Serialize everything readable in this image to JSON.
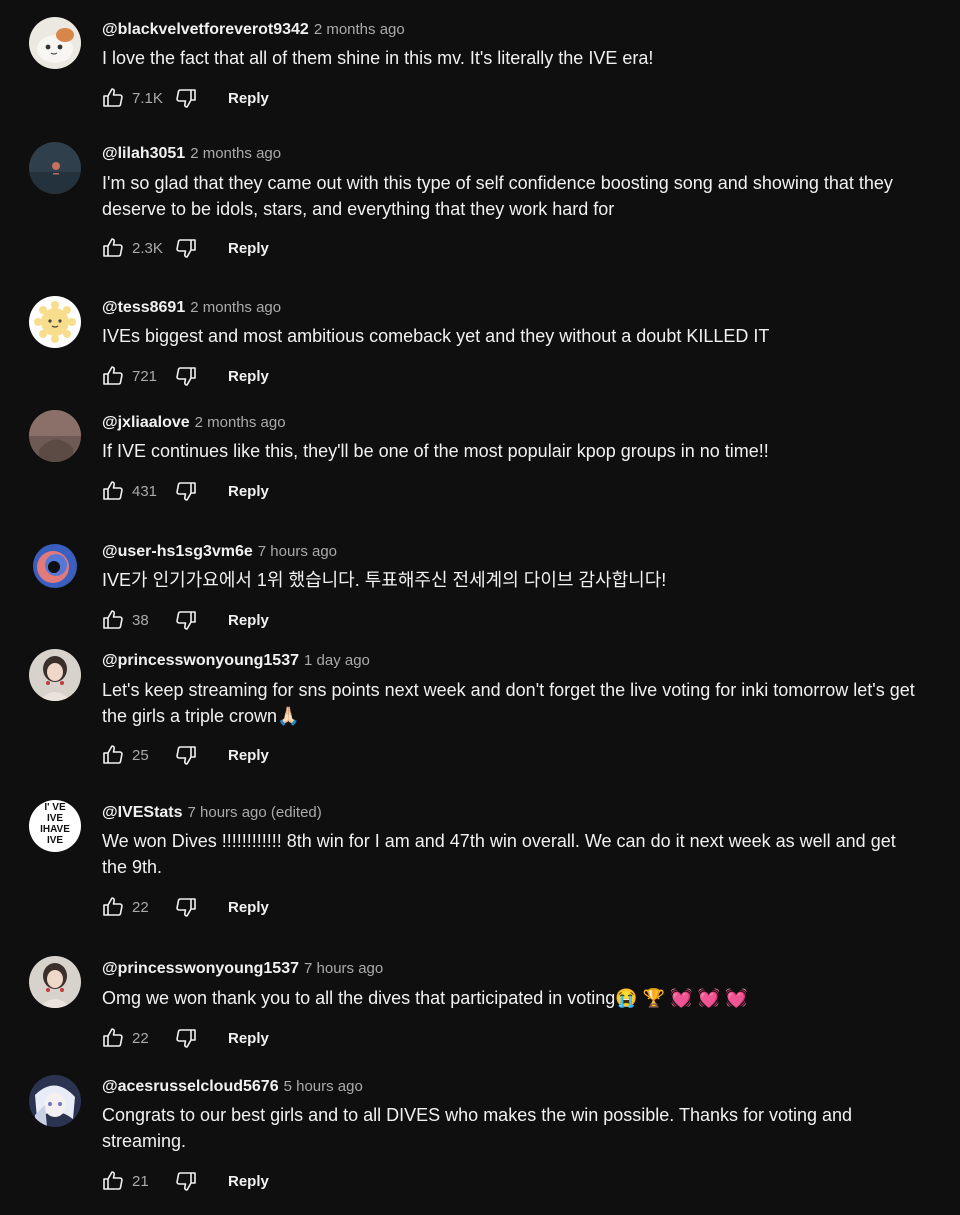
{
  "comments": [
    {
      "author": "@blackvelvetforeverot9342",
      "time": "2 months ago",
      "text": "I love the fact that all of them shine in this mv. It's literally the IVE era!",
      "likes": "7.1K",
      "reply_label": "Reply",
      "avatar": "cat-avatar"
    },
    {
      "author": "@lilah3051",
      "time": "2 months ago",
      "text": "I'm so glad that they came out with this type of self confidence boosting song and showing that they deserve to be idols, stars, and everything that they work hard for",
      "likes": "2.3K",
      "reply_label": "Reply",
      "avatar": "sunset-sea-avatar"
    },
    {
      "author": "@tess8691",
      "time": "2 months ago",
      "text": "IVEs biggest and most ambitious comeback yet and they without a doubt KILLED IT",
      "likes": "721",
      "reply_label": "Reply",
      "avatar": "sun-character-avatar"
    },
    {
      "author": "@jxliaalove",
      "time": "2 months ago",
      "text": "If IVE continues like this, they'll be one of the most populair kpop groups in no time!!",
      "likes": "431",
      "reply_label": "Reply",
      "avatar": "photo-avatar"
    },
    {
      "author": "@user-hs1sg3vm6e",
      "time": "7 hours ago",
      "text": "IVE가 인기가요에서 1위 했습니다. 투표해주신 전세계의 다이브 감사합니다!",
      "likes": "38",
      "reply_label": "Reply",
      "avatar": "swirl-avatar"
    },
    {
      "author": "@princesswonyoung1537",
      "time": "1 day ago",
      "text": "Let's keep streaming for sns points next week and don't forget the live voting for inki tomorrow let's get the girls a triple crown",
      "text_emoji": "🙏🏻",
      "likes": "25",
      "reply_label": "Reply",
      "avatar": "portrait-avatar"
    },
    {
      "author": "@IVEStats",
      "time": "7 hours ago (edited)",
      "text": "We won Dives !!!!!!!!!!!! 8th win for I am and 47th win overall. We can do it next week as well and get the 9th.",
      "likes": "22",
      "reply_label": "Reply",
      "avatar": "ive-text-avatar",
      "avatar_text": [
        "I' VE",
        "IVE",
        "IHAVE",
        "IVE"
      ]
    },
    {
      "author": "@princesswonyoung1537",
      "time": "7 hours ago",
      "text": "Omg we won thank you to all the dives that participated in voting",
      "text_emoji": "😭 🏆 💓 💓 💓",
      "likes": "22",
      "reply_label": "Reply",
      "avatar": "portrait-avatar"
    },
    {
      "author": "@acesrusselcloud5676",
      "time": "5 hours ago",
      "text": "Congrats to our best girls and to all DIVES who makes the win possible. Thanks for voting and streaming.",
      "likes": "21",
      "reply_label": "Reply",
      "avatar": "anime-avatar"
    }
  ]
}
